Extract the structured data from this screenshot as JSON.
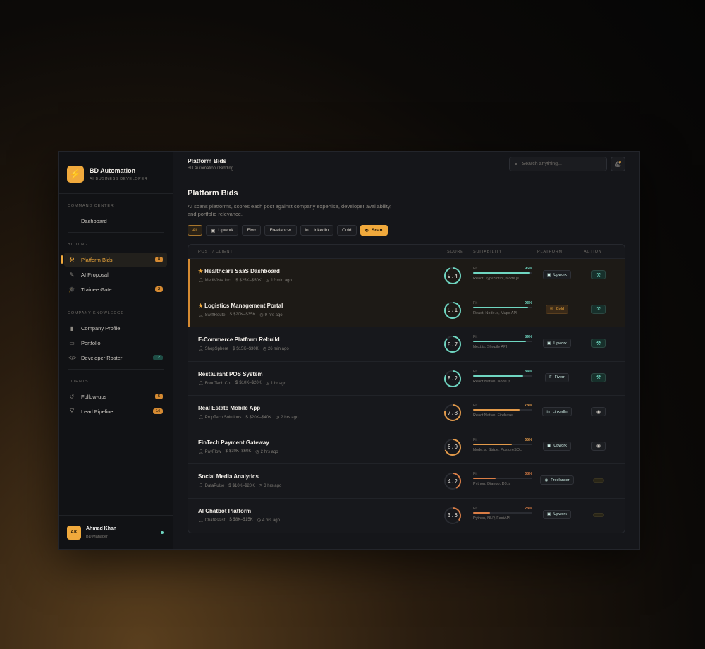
{
  "brand": {
    "title": "BD Automation",
    "subtitle": "AI BUSINESS DEVELOPER",
    "logo_icon": "⚡"
  },
  "sidebar": {
    "sections": [
      {
        "head": "COMMAND CENTER",
        "items": [
          {
            "label": "Dashboard",
            "icon": "",
            "badge": ""
          }
        ]
      },
      {
        "head": "BIDDING",
        "items": [
          {
            "label": "Platform Bids",
            "icon": "⚒",
            "badge": "8",
            "active": true
          },
          {
            "label": "AI Proposal",
            "icon": "✎",
            "badge": ""
          },
          {
            "label": "Trainee Gate",
            "icon": "🎓",
            "badge": "2"
          }
        ]
      },
      {
        "head": "COMPANY KNOWLEDGE",
        "items": [
          {
            "label": "Company Profile",
            "icon": "▮",
            "badge": ""
          },
          {
            "label": "Portfolio",
            "icon": "▭",
            "badge": ""
          },
          {
            "label": "Developer Roster",
            "icon": "</>",
            "badge": "12"
          }
        ]
      },
      {
        "head": "CLIENTS",
        "items": [
          {
            "label": "Follow-ups",
            "icon": "↺",
            "badge": "5"
          },
          {
            "label": "Lead Pipeline",
            "icon": "⛛",
            "badge": "14"
          }
        ]
      }
    ]
  },
  "user": {
    "initials": "AK",
    "name": "Ahmad Khan",
    "role": "BD Manager"
  },
  "topbar": {
    "title": "Platform Bids",
    "breadcrumb": "BD Automation / Bidding",
    "search_placeholder": "Search anything..."
  },
  "page": {
    "title": "Platform Bids",
    "description": "AI scans platforms, scores each post against company expertise, developer availability, and portfolio relevance."
  },
  "filters": [
    {
      "label": "All",
      "icon": "",
      "state": "active"
    },
    {
      "label": "Upwork",
      "icon": "▣",
      "state": ""
    },
    {
      "label": "Fivrr",
      "icon": "",
      "state": ""
    },
    {
      "label": "Freelancer",
      "icon": "",
      "state": ""
    },
    {
      "label": "LinkedIn",
      "icon": "in",
      "state": ""
    },
    {
      "label": "Cold",
      "icon": "",
      "state": ""
    },
    {
      "label": "Scan",
      "icon": "↻",
      "state": "scan"
    }
  ],
  "table": {
    "headers": {
      "post": "POST / CLIENT",
      "score": "SCORE",
      "suitability": "SUITABILITY",
      "platform": "PLATFORM",
      "action": "ACTION"
    },
    "rows": [
      {
        "title": "Healthcare SaaS Dashboard",
        "starred": true,
        "client": "MediVista Inc.",
        "budget": "$25K–$50K",
        "time": "12 min ago",
        "score": "9.4",
        "score_value": 9.4,
        "fit_label": "Fit",
        "fit": "96%",
        "fit_value": 96,
        "skills": "React, TypeScript, Node.js",
        "platform": "Upwork",
        "platform_icon": "▣",
        "platform_style": "",
        "action": "bid",
        "highlight": true,
        "color": "#6fd6c1"
      },
      {
        "title": "Logistics Management Portal",
        "starred": true,
        "client": "SwiftRoute",
        "budget": "$20K–$35K",
        "time": "9 hrs ago",
        "score": "9.1",
        "score_value": 9.1,
        "fit_label": "Fit",
        "fit": "93%",
        "fit_value": 93,
        "skills": "React, Node.js, Maps API",
        "platform": "Cold",
        "platform_icon": "✉",
        "platform_style": "cold",
        "action": "bid",
        "highlight": true,
        "color": "#6fd6c1"
      },
      {
        "title": "E-Commerce Platform Rebuild",
        "starred": false,
        "client": "ShopSphere",
        "budget": "$15K–$30K",
        "time": "26 min ago",
        "score": "8.7",
        "score_value": 8.7,
        "fit_label": "Fit",
        "fit": "89%",
        "fit_value": 89,
        "skills": "Next.js, Shopify API",
        "platform": "Upwork",
        "platform_icon": "▣",
        "platform_style": "",
        "action": "bid",
        "highlight": false,
        "color": "#6fd6c1"
      },
      {
        "title": "Restaurant POS System",
        "starred": false,
        "client": "FoodTech Co.",
        "budget": "$10K–$20K",
        "time": "1 hr ago",
        "score": "8.2",
        "score_value": 8.2,
        "fit_label": "Fit",
        "fit": "84%",
        "fit_value": 84,
        "skills": "React Native, Node.js",
        "platform": "Fiverr",
        "platform_icon": "F",
        "platform_style": "",
        "action": "bid",
        "highlight": false,
        "color": "#6fd6c1"
      },
      {
        "title": "Real Estate Mobile App",
        "starred": false,
        "client": "PropTech Solutions",
        "budget": "$20K–$40K",
        "time": "2 hrs ago",
        "score": "7.8",
        "score_value": 7.8,
        "fit_label": "Fit",
        "fit": "78%",
        "fit_value": 78,
        "skills": "React Native, Firebase",
        "platform": "LinkedIn",
        "platform_icon": "in",
        "platform_style": "",
        "action": "view",
        "highlight": false,
        "color": "#e39a4a"
      },
      {
        "title": "FinTech Payment Gateway",
        "starred": false,
        "client": "PayFlow",
        "budget": "$30K–$60K",
        "time": "2 hrs ago",
        "score": "6.9",
        "score_value": 6.9,
        "fit_label": "Fit",
        "fit": "65%",
        "fit_value": 65,
        "skills": "Node.js, Stripe, PostgreSQL",
        "platform": "Upwork",
        "platform_icon": "▣",
        "platform_style": "",
        "action": "view",
        "highlight": false,
        "color": "#e39a4a"
      },
      {
        "title": "Social Media Analytics",
        "starred": false,
        "client": "DataPulse",
        "budget": "$10K–$20K",
        "time": "3 hrs ago",
        "score": "4.2",
        "score_value": 4.2,
        "fit_label": "Fit",
        "fit": "38%",
        "fit_value": 38,
        "skills": "Python, Django, D3.js",
        "platform": "Freelancer",
        "platform_icon": "◉",
        "platform_style": "",
        "action": "idle",
        "highlight": false,
        "color": "#d97d45"
      },
      {
        "title": "AI Chatbot Platform",
        "starred": false,
        "client": "ChatAssist",
        "budget": "$8K–$15K",
        "time": "4 hrs ago",
        "score": "3.5",
        "score_value": 3.5,
        "fit_label": "Fit",
        "fit": "28%",
        "fit_value": 28,
        "skills": "Python, NLP, FastAPI",
        "platform": "Upwork",
        "platform_icon": "▣",
        "platform_style": "",
        "action": "idle",
        "highlight": false,
        "color": "#d97d45"
      }
    ]
  },
  "colors": {
    "accent": "#f0a93c",
    "teal": "#6fd6c1",
    "orange": "#e39a4a"
  }
}
